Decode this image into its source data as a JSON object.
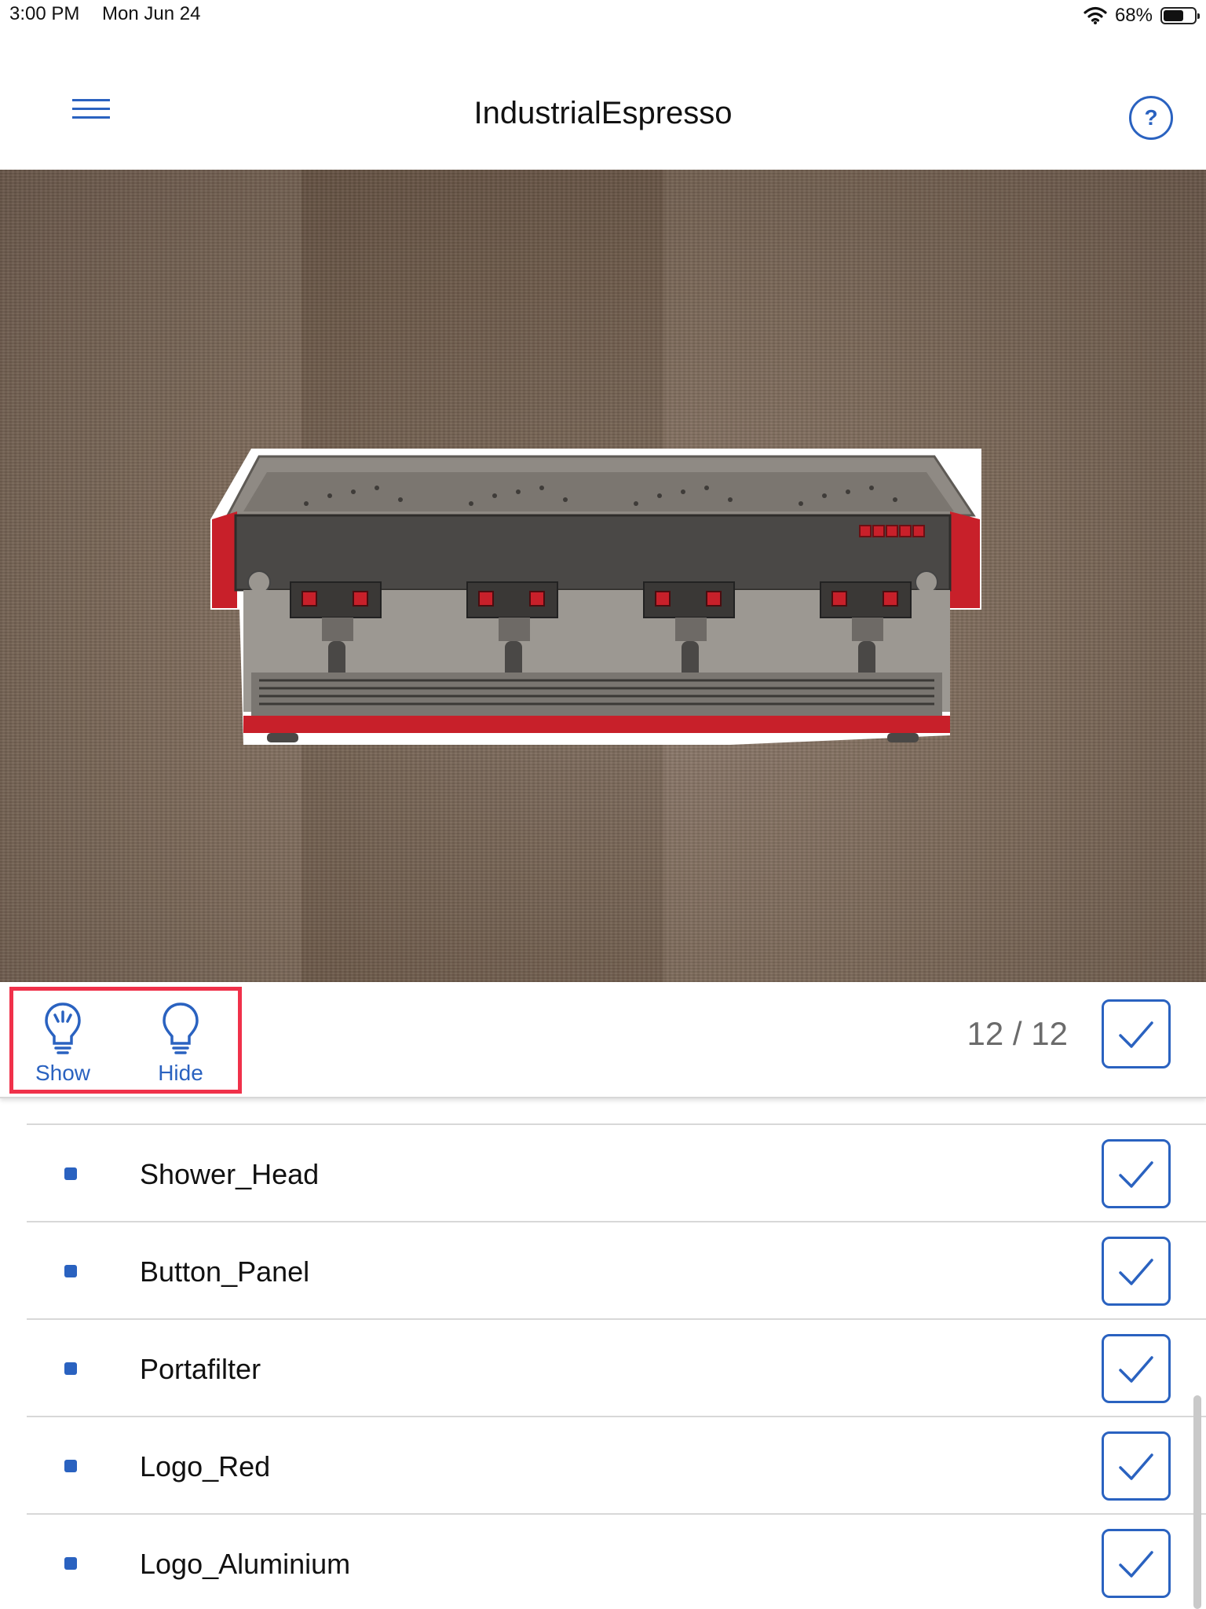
{
  "status_bar": {
    "time": "3:00 PM",
    "date": "Mon Jun 24",
    "battery_percent": "68%",
    "battery_level": 0.68,
    "wifi_icon": "wifi-icon",
    "battery_icon": "battery-icon"
  },
  "header": {
    "title": "IndustrialEspresso",
    "menu_icon": "hamburger-menu-icon",
    "help_label": "?"
  },
  "viewport": {
    "model": "espresso-machine-3d-model",
    "close_icon": "close-icon"
  },
  "toolbar": {
    "show_label": "Show",
    "hide_label": "Hide",
    "show_icon": "lightbulb-on-icon",
    "hide_icon": "lightbulb-off-icon",
    "count": "12 / 12",
    "select_all_checked": true
  },
  "parts_list": {
    "items": [
      {
        "label": "Shower_Head",
        "checked": true
      },
      {
        "label": "Button_Panel",
        "checked": true
      },
      {
        "label": "Portafilter",
        "checked": true
      },
      {
        "label": "Logo_Red",
        "checked": true
      },
      {
        "label": "Logo_Aluminium",
        "checked": true
      }
    ]
  },
  "colors": {
    "accent": "#2a62c0",
    "highlight": "#f0314a",
    "machine_red": "#c8202a",
    "machine_grey": "#8f8a84"
  }
}
